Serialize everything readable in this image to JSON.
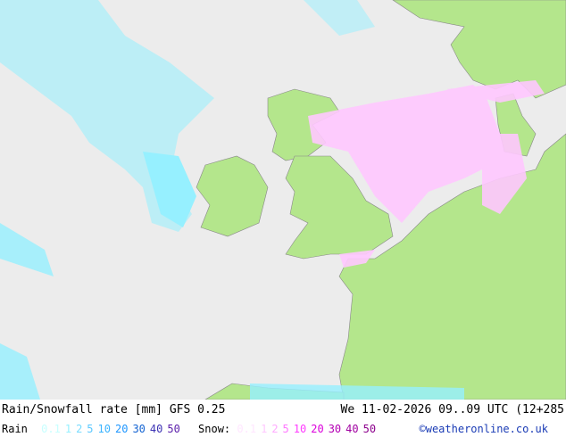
{
  "title": "Rain/Snowfall rate [mm] GFS 0.25",
  "datetime": "We 11-02-2026 09..09 UTC (12+285",
  "rain_label": "Rain",
  "snow_label": "Snow:",
  "rain_scale": [
    {
      "v": "0.1",
      "c": "#c8ffff"
    },
    {
      "v": "1",
      "c": "#96f0ff"
    },
    {
      "v": "2",
      "c": "#78dcff"
    },
    {
      "v": "5",
      "c": "#5ac8ff"
    },
    {
      "v": "10",
      "c": "#3cb4ff"
    },
    {
      "v": "20",
      "c": "#1e96ff"
    },
    {
      "v": "30",
      "c": "#1464d2"
    },
    {
      "v": "40",
      "c": "#3c32b4"
    },
    {
      "v": "50",
      "c": "#5a1eaa"
    }
  ],
  "snow_scale": [
    {
      "v": "0.1",
      "c": "#ffe6ff"
    },
    {
      "v": "1",
      "c": "#ffc8ff"
    },
    {
      "v": "2",
      "c": "#ffaaff"
    },
    {
      "v": "5",
      "c": "#ff78ff"
    },
    {
      "v": "10",
      "c": "#ff3cff"
    },
    {
      "v": "20",
      "c": "#dc00dc"
    },
    {
      "v": "30",
      "c": "#b400b4"
    },
    {
      "v": "40",
      "c": "#a000a0"
    },
    {
      "v": "50",
      "c": "#8c008c"
    }
  ],
  "copyright": "©weatheronline.co.uk",
  "colors": {
    "sea": "#ececec",
    "land": "#b4e68c",
    "rain": "#96f0ff",
    "snow": "#ffc8ff"
  }
}
